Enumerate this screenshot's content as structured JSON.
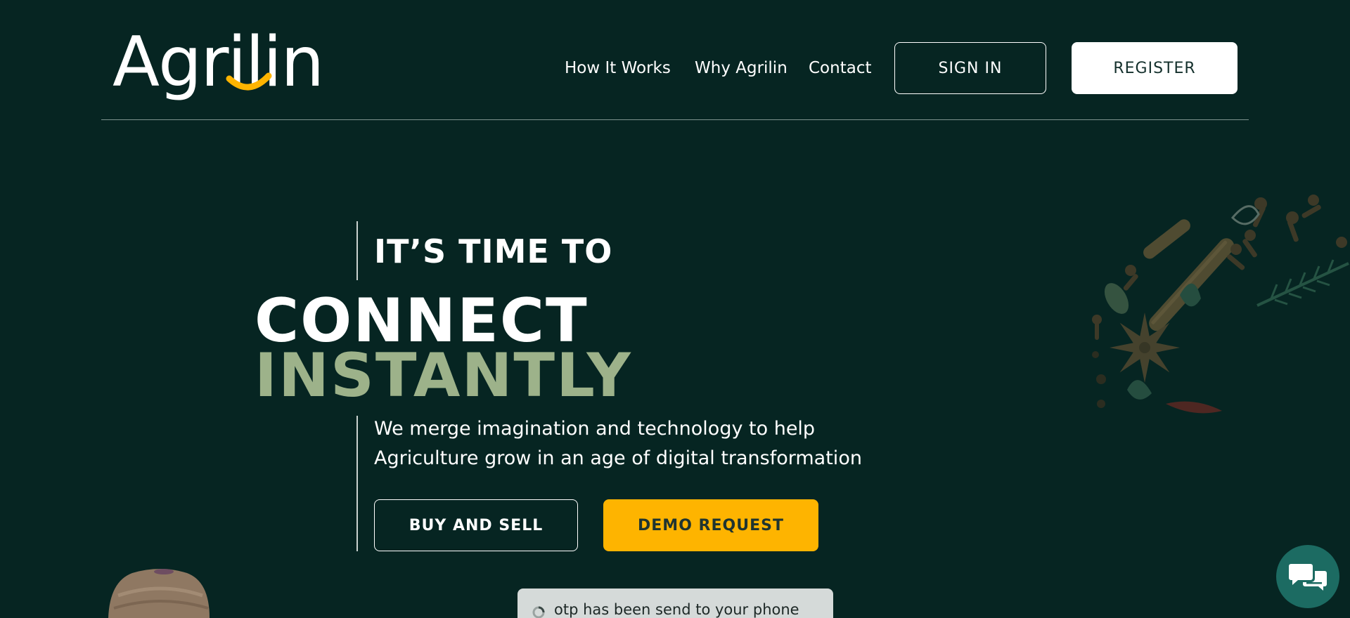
{
  "brand": {
    "logo_text": "Agrilin",
    "accent_color": "#feb400",
    "background_color": "#062522",
    "highlight_color": "#9db28a"
  },
  "nav": {
    "links": [
      {
        "label": "How It Works"
      },
      {
        "label": "Why Agrilin"
      },
      {
        "label": "Contact"
      }
    ],
    "signin_label": "SIGN IN",
    "register_label": "REGISTER"
  },
  "hero": {
    "kicker": "IT’S TIME TO",
    "headline_line1": "CONNECT",
    "headline_line2": "INSTANTLY",
    "subtext": "We merge imagination and technology to help Agriculture grow in an age of digital transformation",
    "buy_sell_label": "BUY AND SELL",
    "demo_label": "DEMO REQUEST"
  },
  "toast": {
    "message": "otp has been send to your phone",
    "icon": "spinner-icon"
  },
  "chat": {
    "icon": "chat-icon"
  },
  "decorations": {
    "spices_icon": "spices-illustration",
    "farmer_icon": "farmer-photo"
  }
}
